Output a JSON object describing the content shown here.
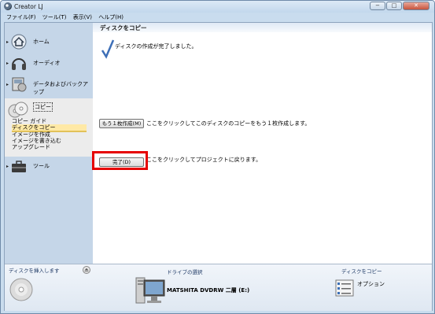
{
  "window": {
    "title": "Creator LJ"
  },
  "window_buttons": {
    "minimize": "−",
    "maximize": "□",
    "close": "✕"
  },
  "menu": [
    "ファイル(F)",
    "ツール(T)",
    "表示(V)",
    "ヘルプ(H)"
  ],
  "sidebar": {
    "items": [
      {
        "label": "ホーム",
        "icon": "home-icon"
      },
      {
        "label": "オーディオ",
        "icon": "headphones-icon"
      },
      {
        "label": "データおよびバックアップ",
        "icon": "data-backup-icon"
      },
      {
        "label": "コピー",
        "icon": "copy-discs-icon"
      },
      {
        "label": "ツール",
        "icon": "toolbox-icon"
      }
    ],
    "copy_subitems": [
      "コピー ガイド",
      "ディスクをコピー",
      "イメージを作成",
      "イメージを書き込む",
      "アップグレード"
    ]
  },
  "main": {
    "title": "ディスクをコピー",
    "complete_message": "ディスクの作成が完了しました。",
    "more_button": "もう１枚作成(M)",
    "more_desc": "ここをクリックしてこのディスクのコピーをもう１枚作成します。",
    "done_button": "完了(D)",
    "done_desc": "ここをクリックしてプロジェクトに戻ります。"
  },
  "bottom": {
    "insert_label": "ディスクを挿入します",
    "drive_heading": "ドライブの選択",
    "drive_name": "MATSHITA DVDRW 二層 (E:)",
    "task_heading": "ディスクをコピー",
    "options_label": "オプション"
  }
}
